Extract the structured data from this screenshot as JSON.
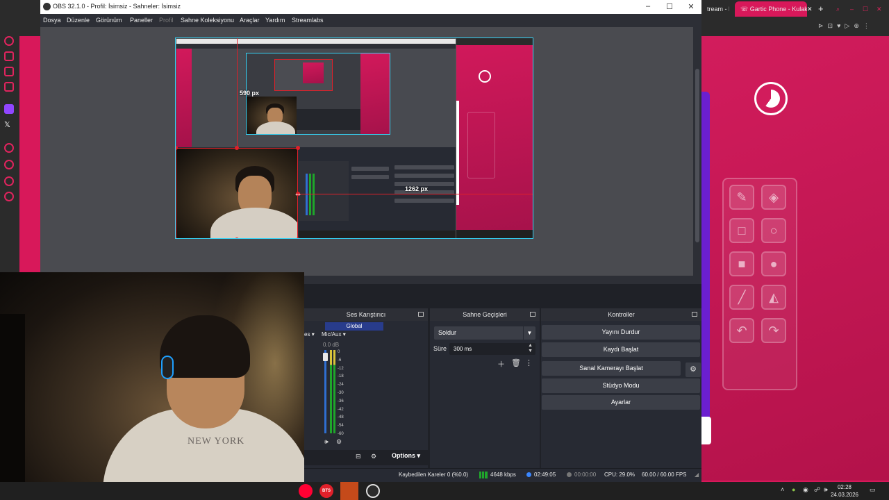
{
  "browser": {
    "tabs": [
      {
        "title": "tream - K"
      },
      {
        "title": "Gartic Phone - Kulak"
      }
    ],
    "new_tab_label": "+",
    "accent": "#d8185a"
  },
  "obs": {
    "window_title": "OBS 32.1.0 - Profil: İsimsiz - Sahneler: İsimsiz",
    "menu": [
      {
        "label": "Dosya",
        "enabled": true
      },
      {
        "label": "Düzenle",
        "enabled": true
      },
      {
        "label": "Görünüm",
        "enabled": true
      },
      {
        "label": "Paneller",
        "enabled": true
      },
      {
        "label": "Profil",
        "enabled": false
      },
      {
        "label": "Sahne Koleksiyonu",
        "enabled": true
      },
      {
        "label": "Araçlar",
        "enabled": true
      },
      {
        "label": "Yardım",
        "enabled": true
      },
      {
        "label": "Streamlabs",
        "enabled": true
      }
    ],
    "preview": {
      "height_label": "590 px",
      "width_label": "1262 px",
      "selection_color": "#e0202a",
      "canvas_border_color": "#35d2f5"
    },
    "mixer": {
      "title": "Ses Karıştırıcı",
      "channel_global": "Global",
      "channel_mic": "Mic/Aux",
      "channel_left": "es",
      "level": "0.0 dB",
      "scale": [
        "0",
        "-6",
        "-12",
        "-18",
        "-24",
        "-30",
        "-36",
        "-42",
        "-48",
        "-54",
        "-60"
      ],
      "options_label": "Options"
    },
    "transitions": {
      "title": "Sahne Geçişleri",
      "selected": "Soldur",
      "duration_label": "Süre",
      "duration_value": "300 ms"
    },
    "controls": {
      "title": "Kontroller",
      "buttons": [
        "Yayını Durdur",
        "Kaydı Başlat",
        "Sanal Kamerayı Başlat",
        "Stüdyo Modu",
        "Ayarlar"
      ]
    },
    "status": {
      "dropped": "Kaybedilen Kareler 0 (%0.0)",
      "bitrate": "4648 kbps",
      "stream_time": "02:49:05",
      "rec_time": "00:00:00",
      "cpu": "CPU: 29.0%",
      "fps": "60.00 / 60.00 FPS"
    }
  },
  "webcam": {
    "shirt_text": "NEW YORK"
  },
  "taskbar": {
    "time": "02:28",
    "date": "24.03.2026",
    "app_label": "BTS"
  }
}
